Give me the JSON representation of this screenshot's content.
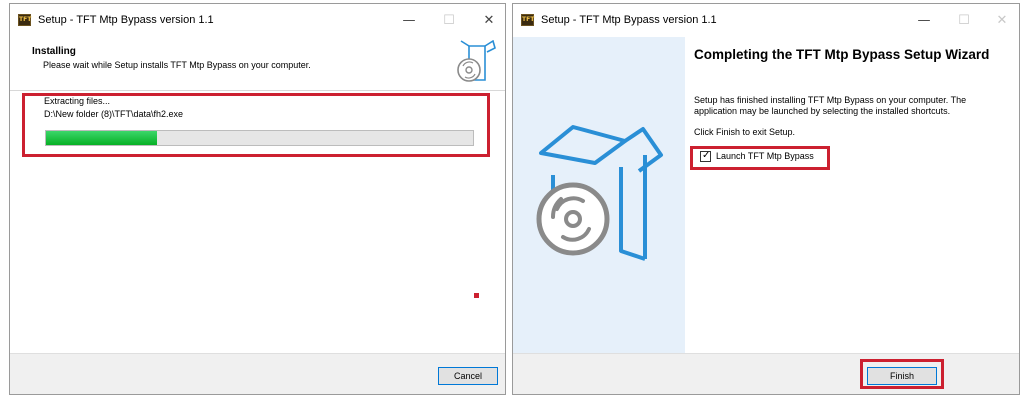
{
  "left_window": {
    "app_icon_text": "TFT",
    "title": "Setup - TFT Mtp Bypass version 1.1",
    "controls": {
      "minimize": "—",
      "maximize": "☐",
      "close": "✕"
    },
    "header_title": "Installing",
    "header_subtitle": "Please wait while Setup installs TFT Mtp Bypass on your computer.",
    "status_text": "Extracting files...",
    "file_path": "D:\\New folder (8)\\TFT\\data\\fh2.exe",
    "progress_fraction": 0.26,
    "cancel_label": "Cancel"
  },
  "right_window": {
    "app_icon_text": "TFT",
    "title": "Setup - TFT Mtp Bypass version 1.1",
    "controls": {
      "minimize": "—",
      "maximize": "☐",
      "close": "✕"
    },
    "wizard_title": "Completing the TFT Mtp Bypass Setup Wizard",
    "finished_line1": "Setup has finished installing TFT Mtp Bypass on your computer. The",
    "finished_line2": "application may be launched by selecting the installed shortcuts.",
    "exit_text": "Click Finish to exit Setup.",
    "launch_checkbox_label": "Launch TFT Mtp Bypass",
    "launch_checked": true,
    "check_glyph": "✓",
    "finish_label": "Finish"
  },
  "colors": {
    "highlight": "#cc2030",
    "progress": "#06b025",
    "focus": "#0078d7",
    "icon_blue": "#2a8fd6",
    "disc_gray": "#8a8a8a"
  }
}
